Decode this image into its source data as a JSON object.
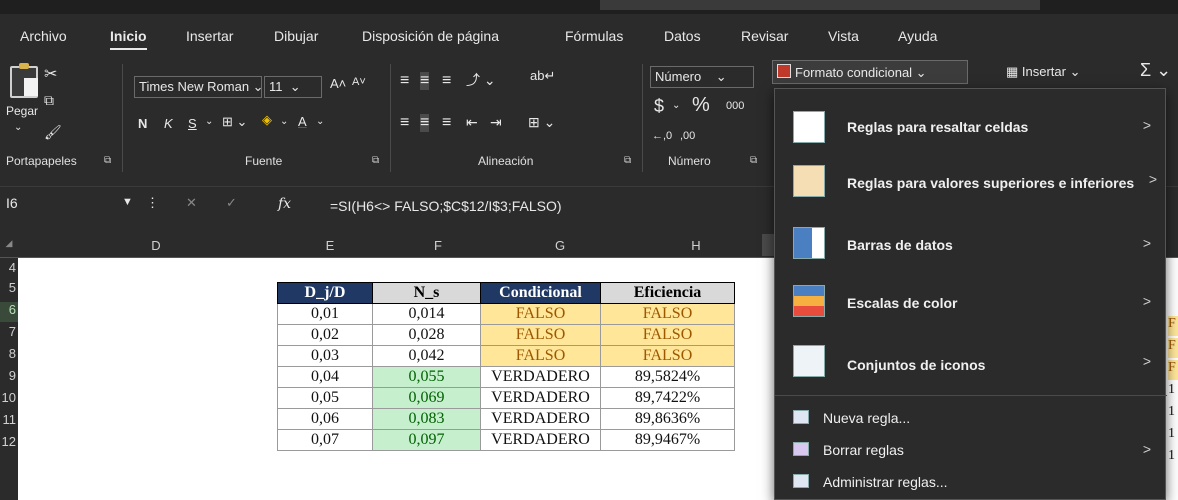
{
  "menu": {
    "tabs": [
      "Archivo",
      "Inicio",
      "Insertar",
      "Dibujar",
      "Disposición de página",
      "Fórmulas",
      "Datos",
      "Revisar",
      "Vista",
      "Ayuda"
    ],
    "active": "Inicio"
  },
  "ribbon": {
    "paste_label": "Pegar",
    "font_name": "Times New Roman",
    "font_size": "11",
    "grow_font": "A˄",
    "shrink_font": "A˅",
    "bold": "N",
    "italic": "K",
    "underline": "S",
    "font_color_letter": "A",
    "number_format": "Número",
    "currency": "$",
    "percent": "%",
    "thousands": "000",
    "dec_inc": "←,0",
    "dec_dec": ",00",
    "cond_format": "Formato condicional",
    "insert": "Insertar",
    "sum_symbol": "Σ",
    "groups": {
      "clipboard": "Portapapeles",
      "font": "Fuente",
      "alignment": "Alineación",
      "number": "Número"
    }
  },
  "formula_bar": {
    "name_box": "I6",
    "fx": "fx",
    "formula": "=SI(H6<> FALSO;$C$12/I$3;FALSO)"
  },
  "grid": {
    "columns": [
      "D",
      "E",
      "F",
      "G",
      "H"
    ],
    "rows": [
      "4",
      "5",
      "6",
      "7",
      "8",
      "9",
      "10",
      "11",
      "12"
    ],
    "selected_row": "6",
    "table_headers": [
      "D_j/D",
      "N_s",
      "Condicional",
      "Eficiencia"
    ],
    "table_rows": [
      [
        "0,01",
        "0,014",
        "FALSO",
        "FALSO"
      ],
      [
        "0,02",
        "0,028",
        "FALSO",
        "FALSO"
      ],
      [
        "0,03",
        "0,042",
        "FALSO",
        "FALSO"
      ],
      [
        "0,04",
        "0,055",
        "VERDADERO",
        "89,5824%"
      ],
      [
        "0,05",
        "0,069",
        "VERDADERO",
        "89,7422%"
      ],
      [
        "0,06",
        "0,083",
        "VERDADERO",
        "89,8636%"
      ],
      [
        "0,07",
        "0,097",
        "VERDADERO",
        "89,9467%"
      ]
    ],
    "right_edge_partial": [
      "F",
      "F",
      "F",
      "1",
      "1",
      "1",
      "1"
    ]
  },
  "cf_menu": {
    "items": [
      {
        "label": "Reglas para resaltar celdas",
        "submenu": true
      },
      {
        "label": "Reglas para valores superiores e inferiores",
        "submenu": true
      },
      {
        "label": "Barras de datos",
        "submenu": true
      },
      {
        "label": "Escalas de color",
        "submenu": true
      },
      {
        "label": "Conjuntos de iconos",
        "submenu": true
      },
      {
        "label": "Nueva regla...",
        "submenu": false
      },
      {
        "label": "Borrar reglas",
        "submenu": true
      },
      {
        "label": "Administrar reglas...",
        "submenu": false
      }
    ],
    "arrow": ">"
  },
  "colors": {
    "header_navy": "#1f3864",
    "false_fill": "#ffe699",
    "green_fill": "#c6efce",
    "dark_bg": "#2b2b2b"
  }
}
